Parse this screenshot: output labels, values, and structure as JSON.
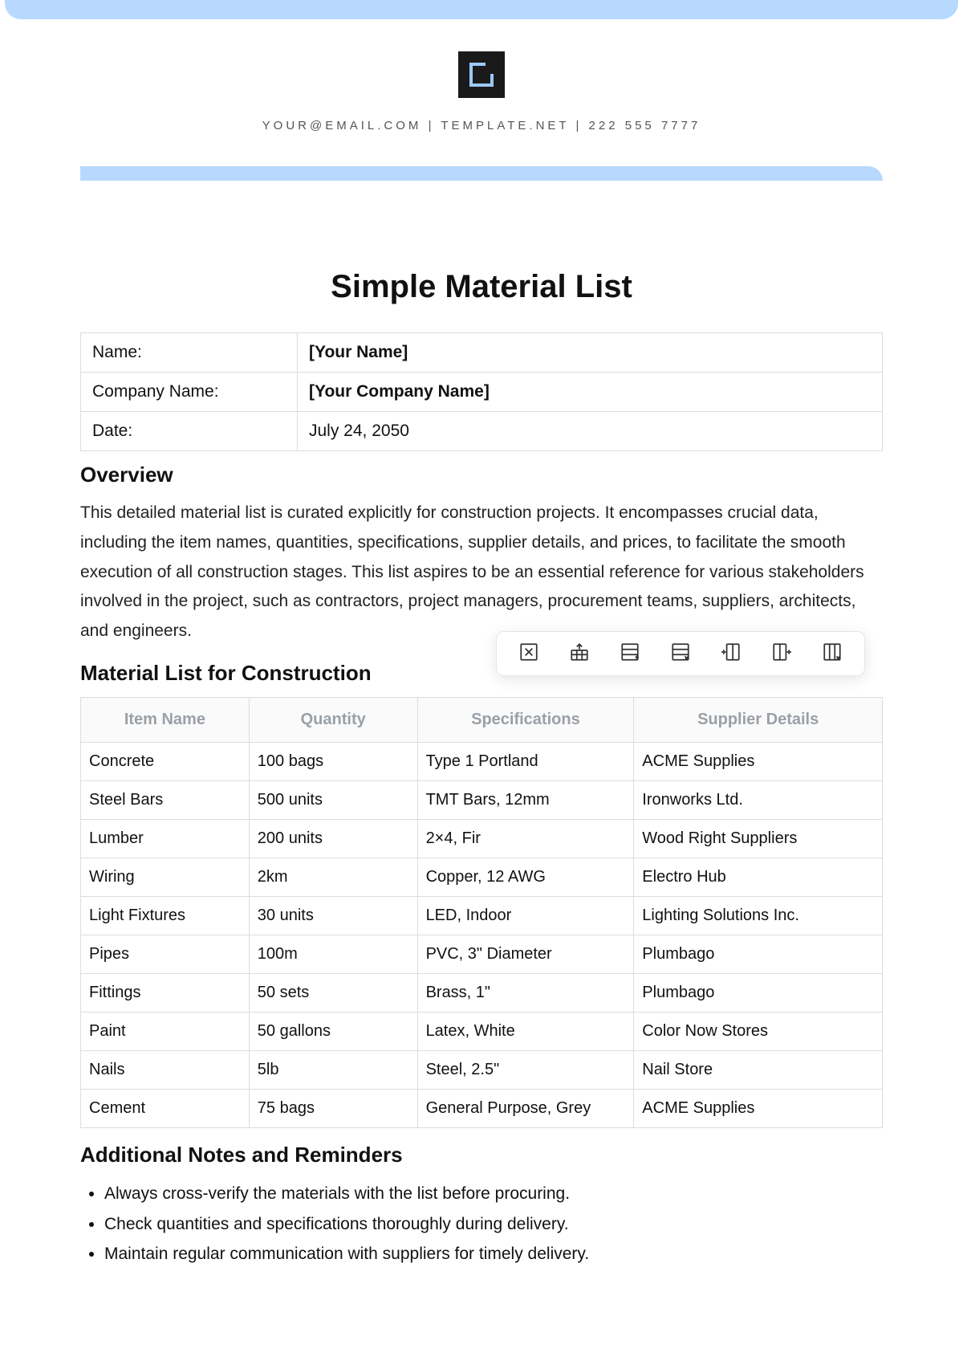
{
  "header": {
    "contact_line": "YOUR@EMAIL.COM | TEMPLATE.NET | 222 555 7777"
  },
  "title": "Simple Material List",
  "info": {
    "rows": [
      {
        "label": "Name:",
        "value": "[Your Name]"
      },
      {
        "label": "Company Name:",
        "value": "[Your Company Name]"
      },
      {
        "label": "Date:",
        "value": "July 24, 2050"
      }
    ]
  },
  "overview": {
    "heading": "Overview",
    "body": "This detailed material list is curated explicitly for construction projects. It encompasses crucial data, including the item names, quantities, specifications, supplier details, and prices, to facilitate the smooth execution of all construction stages. This list aspires to be an essential reference for various stakeholders involved in the project, such as contractors, project managers, procurement teams, suppliers, architects, and engineers."
  },
  "materials": {
    "heading": "Material List for Construction",
    "columns": [
      "Item Name",
      "Quantity",
      "Specifications",
      "Supplier Details"
    ],
    "rows": [
      {
        "item": "Concrete",
        "qty": "100 bags",
        "spec": "Type 1 Portland",
        "supplier": "ACME Supplies"
      },
      {
        "item": "Steel Bars",
        "qty": "500 units",
        "spec": "TMT Bars, 12mm",
        "supplier": "Ironworks Ltd."
      },
      {
        "item": "Lumber",
        "qty": "200 units",
        "spec": "2×4, Fir",
        "supplier": "Wood Right Suppliers"
      },
      {
        "item": "Wiring",
        "qty": "2km",
        "spec": "Copper, 12 AWG",
        "supplier": "Electro Hub"
      },
      {
        "item": "Light Fixtures",
        "qty": "30 units",
        "spec": "LED, Indoor",
        "supplier": "Lighting Solutions Inc."
      },
      {
        "item": "Pipes",
        "qty": "100m",
        "spec": "PVC, 3\" Diameter",
        "supplier": "Plumbago"
      },
      {
        "item": "Fittings",
        "qty": "50 sets",
        "spec": "Brass, 1\"",
        "supplier": "Plumbago"
      },
      {
        "item": "Paint",
        "qty": "50 gallons",
        "spec": "Latex, White",
        "supplier": "Color Now Stores"
      },
      {
        "item": "Nails",
        "qty": "5lb",
        "spec": "Steel, 2.5\"",
        "supplier": "Nail Store"
      },
      {
        "item": "Cement",
        "qty": "75 bags",
        "spec": "General Purpose, Grey",
        "supplier": "ACME Supplies"
      }
    ]
  },
  "notes": {
    "heading": "Additional Notes and Reminders",
    "items": [
      "Always cross-verify the materials with the list before procuring.",
      "Check quantities and specifications thoroughly during delivery.",
      "Maintain regular communication with suppliers for timely delivery."
    ]
  },
  "toolbar": {
    "buttons": [
      {
        "name": "delete-table-icon"
      },
      {
        "name": "table-share-icon"
      },
      {
        "name": "add-row-icon"
      },
      {
        "name": "delete-row-icon"
      },
      {
        "name": "add-column-icon"
      },
      {
        "name": "insert-column-icon"
      },
      {
        "name": "delete-column-icon"
      }
    ]
  }
}
